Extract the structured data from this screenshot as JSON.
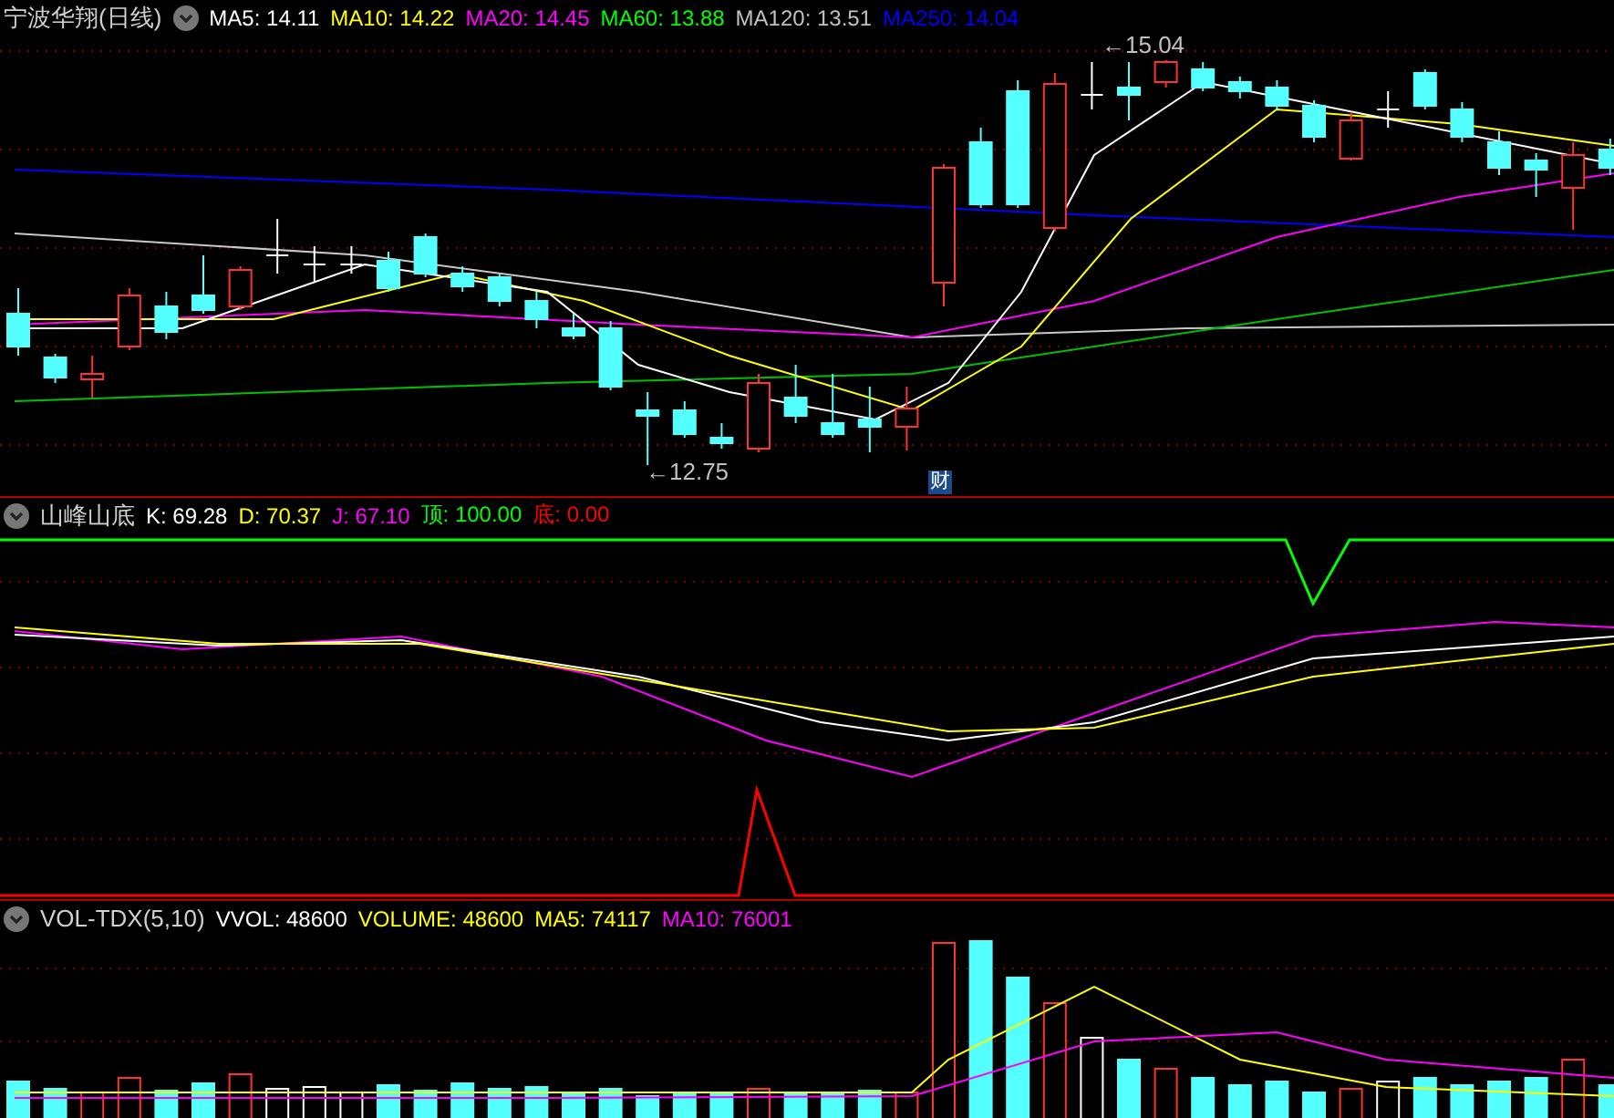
{
  "main_panel": {
    "title": "宁波华翔(日线)",
    "legend": [
      {
        "text": "MA5: 14.11",
        "color": "#ffffff"
      },
      {
        "text": "MA10: 14.22",
        "color": "#ffff00"
      },
      {
        "text": "MA20: 14.45",
        "color": "#ff00ff"
      },
      {
        "text": "MA60: 13.88",
        "color": "#00ff00"
      },
      {
        "text": "MA120: 13.51",
        "color": "#c0c0c0"
      },
      {
        "text": "MA250: 14.04",
        "color": "#0000ff"
      }
    ],
    "high_label": "←15.04",
    "low_label": "←12.75",
    "event_marker": "财"
  },
  "indicator_panel": {
    "title": "山峰山底",
    "legend": [
      {
        "text": "K: 69.28",
        "color": "#ffffff"
      },
      {
        "text": "D: 70.37",
        "color": "#ffff00"
      },
      {
        "text": "J: 67.10",
        "color": "#ff00ff"
      },
      {
        "text": "顶: 100.00",
        "color": "#00ff00"
      },
      {
        "text": "底: 0.00",
        "color": "#ff0000"
      }
    ]
  },
  "volume_panel": {
    "title": "VOL-TDX(5,10)",
    "legend": [
      {
        "text": "VVOL: 48600",
        "color": "#ffffff"
      },
      {
        "text": "VOLUME: 48600",
        "color": "#ffff00"
      },
      {
        "text": "MA5: 74117",
        "color": "#ffff00"
      },
      {
        "text": "MA10: 76001",
        "color": "#ff00ff"
      }
    ]
  }
}
